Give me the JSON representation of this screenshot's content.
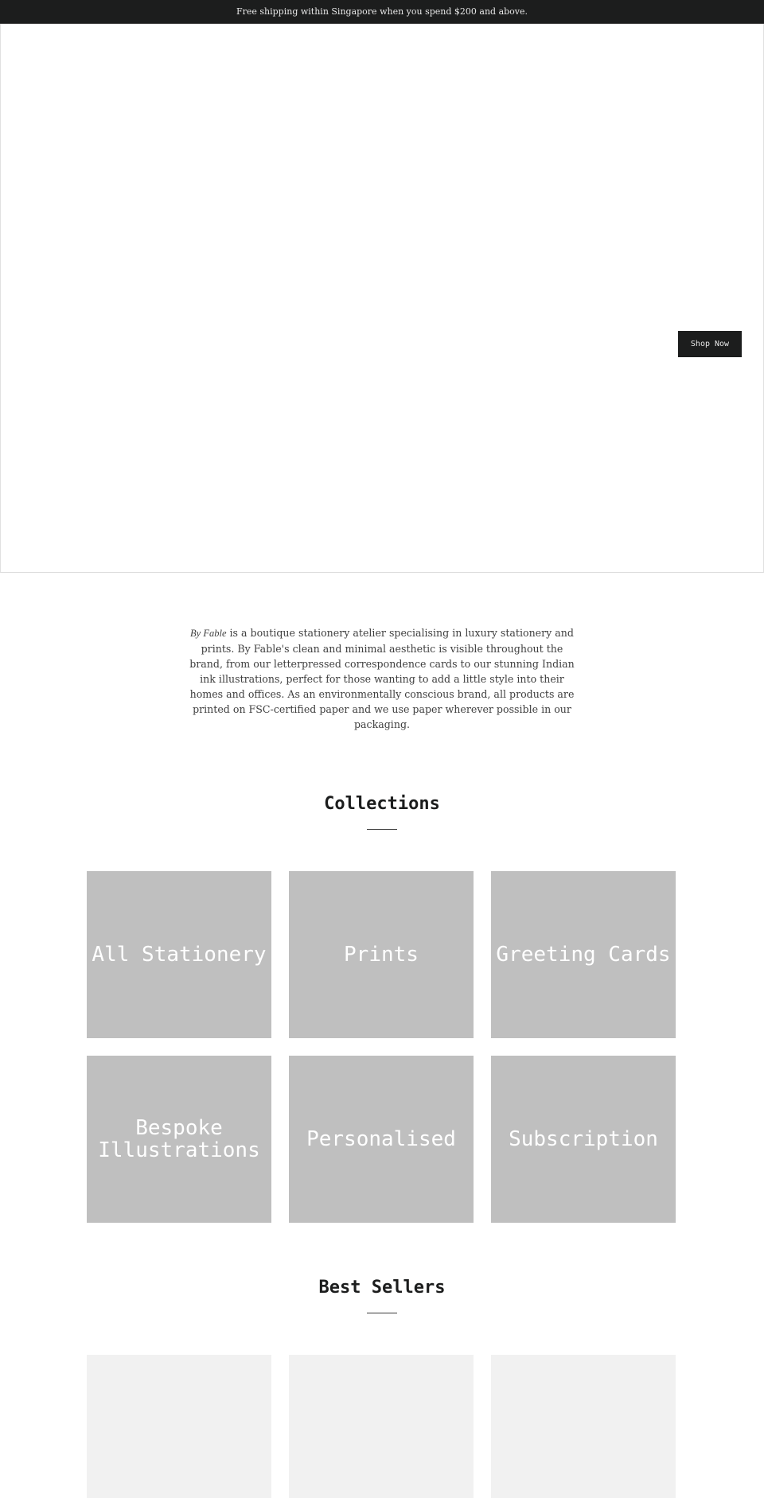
{
  "announcement": {
    "text": "Free shipping within Singapore when you spend $200 and above."
  },
  "hero": {
    "cta_label": "Shop Now"
  },
  "intro": {
    "brand": "By Fable",
    "text": " is a boutique stationery atelier specialising in luxury stationery and prints. By Fable's clean and minimal aesthetic is visible throughout the brand, from our letterpressed correspondence cards to our stunning Indian ink illustrations, perfect for those wanting to add a little style into their homes and offices. As an environmentally conscious brand, all products are printed on FSC-certified paper and we use paper wherever possible in our packaging."
  },
  "collections": {
    "title": "Collections",
    "items": [
      {
        "label": "All Stationery"
      },
      {
        "label": "Prints"
      },
      {
        "label": "Greeting Cards"
      },
      {
        "label": "Bespoke Illustrations"
      },
      {
        "label": "Personalised"
      },
      {
        "label": "Subscription"
      }
    ]
  },
  "best_sellers": {
    "title": "Best Sellers",
    "products": [
      {
        "label": ""
      },
      {
        "label": ""
      },
      {
        "label": ""
      }
    ]
  },
  "colors": {
    "dark": "#1c1d1d",
    "tile": "#bfbfbf",
    "product_placeholder": "#f1f1f1"
  }
}
